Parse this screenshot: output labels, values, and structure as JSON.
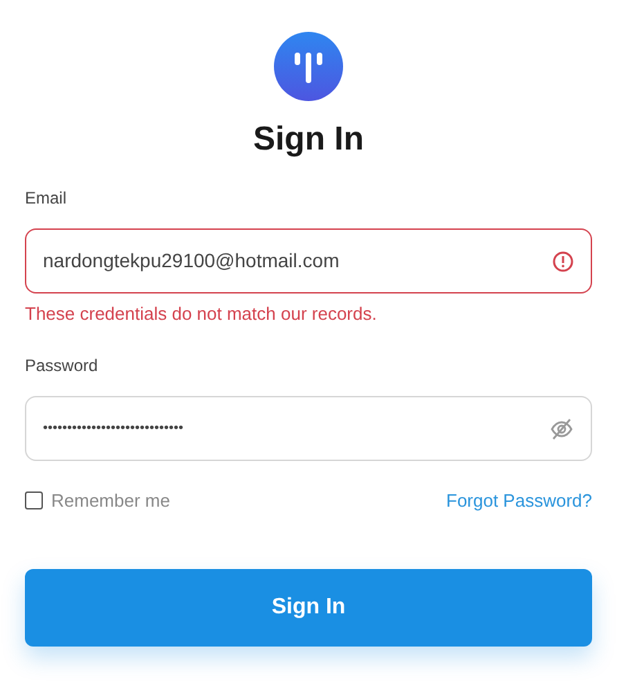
{
  "title": "Sign In",
  "email": {
    "label": "Email",
    "value": "nardongtekpu29100@hotmail.com",
    "invalid": true,
    "error": "These credentials do not match our records."
  },
  "password": {
    "label": "Password",
    "value": "•••••••••••••••••••••••••••••"
  },
  "remember": {
    "label": "Remember me",
    "checked": false
  },
  "forgot_link": "Forgot Password?",
  "submit": "Sign In"
}
